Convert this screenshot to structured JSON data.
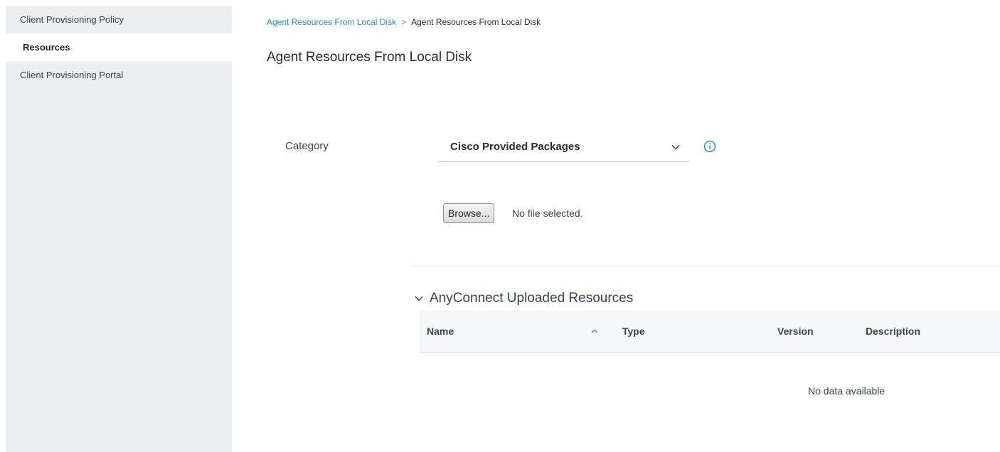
{
  "sidebar": {
    "items": [
      {
        "label": "Client Provisioning Policy"
      },
      {
        "label": "Resources"
      },
      {
        "label": "Client Provisioning Portal"
      }
    ]
  },
  "breadcrumb": {
    "link": "Agent Resources From Local Disk",
    "separator": ">",
    "current": "Agent Resources From Local Disk"
  },
  "page": {
    "title": "Agent Resources From Local Disk"
  },
  "form": {
    "category_label": "Category",
    "category_value": "Cisco Provided Packages",
    "browse_label": "Browse...",
    "file_status": "No file selected."
  },
  "section": {
    "title": "AnyConnect Uploaded Resources"
  },
  "table": {
    "columns": [
      "Name",
      "Type",
      "Version",
      "Description"
    ],
    "empty_message": "No data available"
  },
  "icons": {
    "category_chevron": "chevron-down-icon",
    "info": "info-icon",
    "section_chevron": "chevron-down-icon",
    "sort": "sort-ascending-icon"
  },
  "colors": {
    "sidebar_bg": "#eceef1",
    "link": "#1e8bc3",
    "info_icon": "#1e8bc3"
  }
}
